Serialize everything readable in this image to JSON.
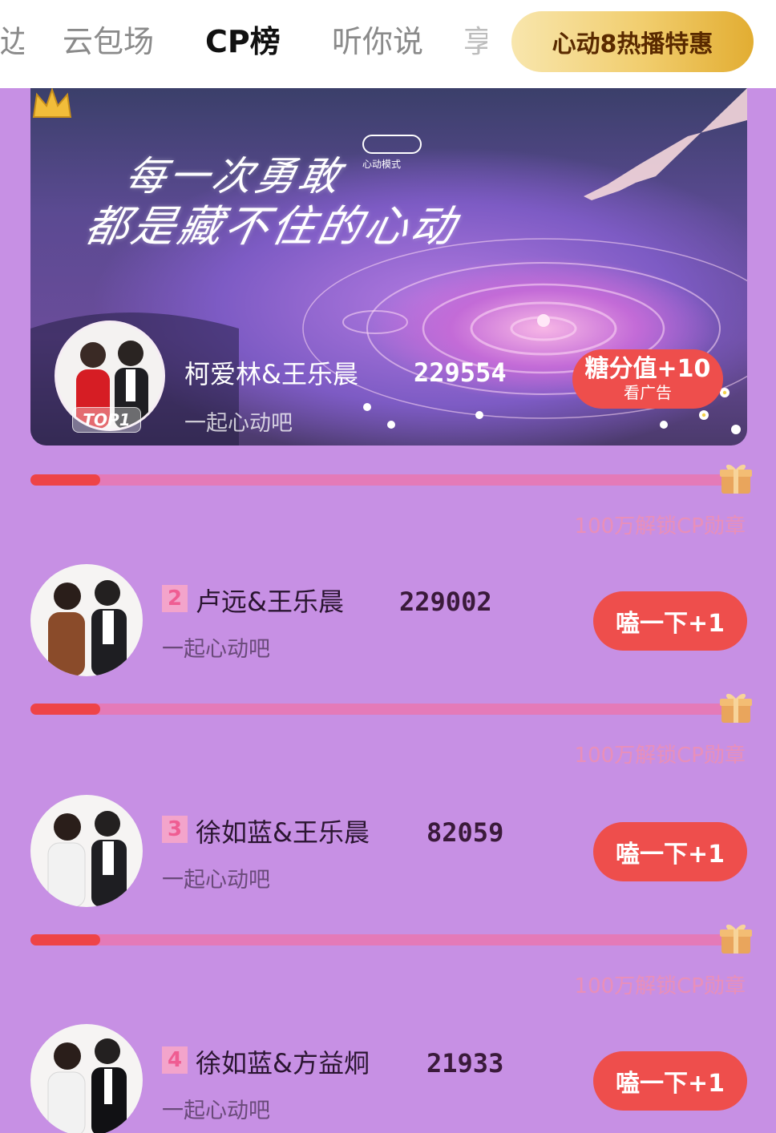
{
  "nav": {
    "tabs": [
      {
        "label": "边"
      },
      {
        "label": "云包场"
      },
      {
        "label": "CP榜"
      },
      {
        "label": "听你说"
      },
      {
        "label": "享"
      }
    ],
    "active_tab": "CP榜",
    "promo_label": "心动8热播特惠"
  },
  "banner": {
    "title_line1": "每一次勇敢",
    "title_line2": "都是藏不住的心动",
    "mode_label": "心动模式",
    "top_badge": "TOP1",
    "entry": {
      "rank": "1",
      "name": "柯爱林&王乐晨",
      "score": "229554",
      "subtitle": "一起心动吧"
    },
    "sugar_button": {
      "label": "糖分值+10",
      "sub_label": "看广告"
    }
  },
  "progress": {
    "unlock_text": "100万解锁CP勋章",
    "fill_fraction": 0.1
  },
  "list": [
    {
      "rank": "2",
      "name": "卢远&王乐晨",
      "score": "229002",
      "subtitle": "一起心动吧",
      "button": "嗑一下+1"
    },
    {
      "rank": "3",
      "name": "徐如蓝&王乐晨",
      "score": "82059",
      "subtitle": "一起心动吧",
      "button": "嗑一下+1"
    },
    {
      "rank": "4",
      "name": "徐如蓝&方益炯",
      "score": "21933",
      "subtitle": "一起心动吧",
      "button": "嗑一下+1"
    }
  ],
  "colors": {
    "page_bg": "#c790e4",
    "accent_red": "#ee4e4c",
    "progress_track": "#e47ab8",
    "promo_gold": "#f1cd6d"
  }
}
